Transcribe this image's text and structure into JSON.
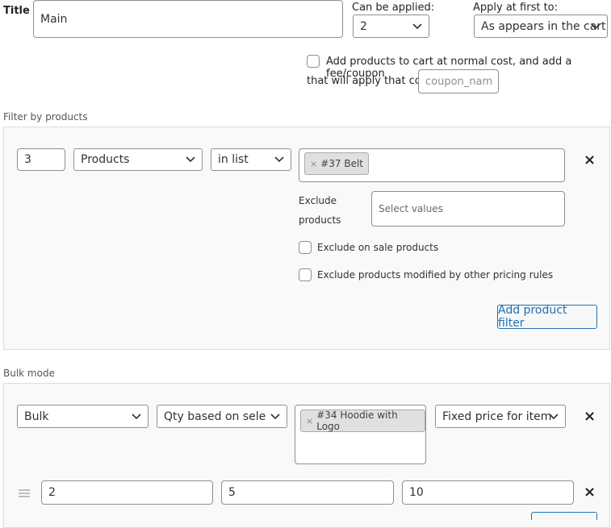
{
  "header": {
    "title_label": "Title",
    "title_value": "Main",
    "can_be_applied_label": "Can be applied:",
    "can_be_applied_value": "2",
    "apply_first_label": "Apply at first to:",
    "apply_first_value": "As appears in the cart",
    "add_products_line1": "Add products to cart at normal cost, and add a fee/coupon",
    "add_products_line2": "that will apply that cost",
    "coupon_placeholder": "coupon_name"
  },
  "filter": {
    "section_label": "Filter by products",
    "qty_value": "3",
    "type_value": "Products",
    "method_value": "in list",
    "selected_tag": "#37 Belt",
    "exclude_label_1": "Exclude",
    "exclude_label_2": "products",
    "exclude_placeholder": "Select values",
    "exclude_on_sale_label": "Exclude on sale products",
    "exclude_modified_label": "Exclude products modified by other pricing rules",
    "add_filter_label": "Add product filter",
    "remove_symbol": "×"
  },
  "bulk": {
    "section_label": "Bulk mode",
    "mode_value": "Bulk",
    "qty_based_value": "Qty based on selected products",
    "selected_tag": "#34 Hoodie with Logo",
    "price_type_value": "Fixed price for item",
    "remove_symbol": "×",
    "range_row": {
      "from": "2",
      "to": "5",
      "value": "10",
      "remove_symbol": "×"
    }
  },
  "colors": {
    "accent": "#2271b1",
    "border": "#8c8f94",
    "panel_bg": "#f9f9f9"
  },
  "icons": {
    "chevron": "chevron-down-icon",
    "drag": "drag-handle-icon",
    "remove": "close-icon"
  }
}
